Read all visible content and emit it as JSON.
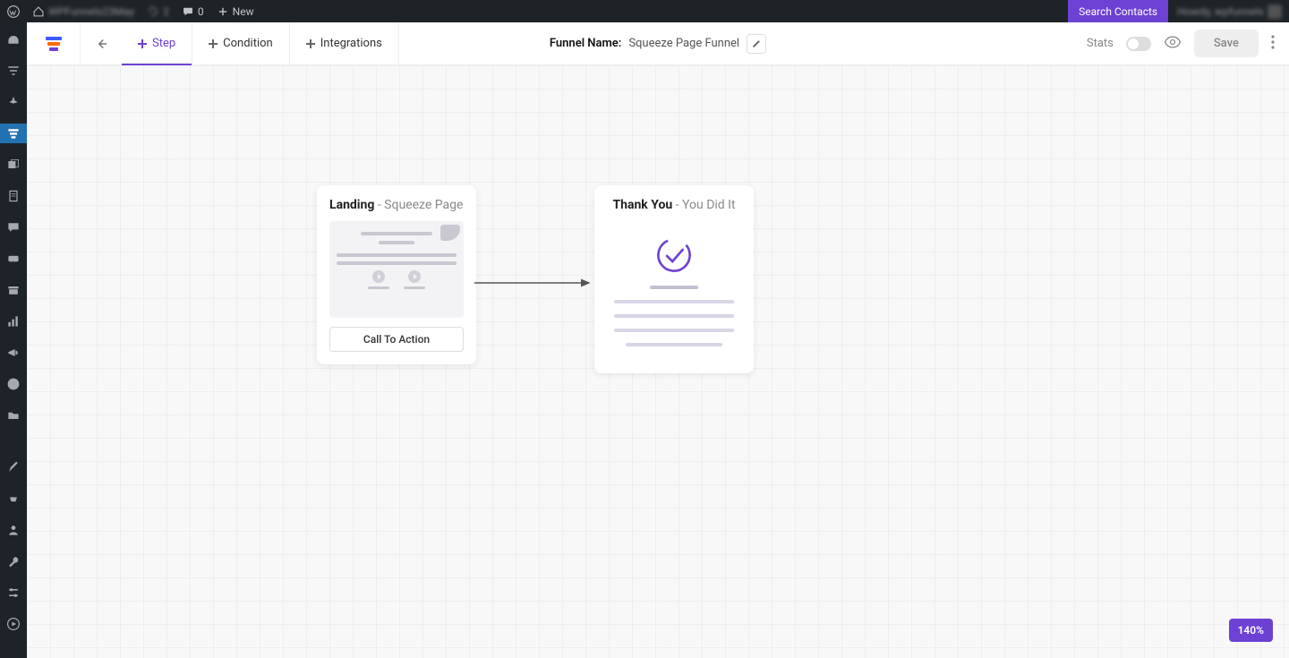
{
  "adminbar": {
    "site_name": "WPFunnels23May",
    "notif_count": "2",
    "comment_count": "0",
    "new_label": "New",
    "search_contacts": "Search Contacts",
    "howdy": "Howdy, wpfunnels"
  },
  "toolbar": {
    "tabs": {
      "step": "Step",
      "condition": "Condition",
      "integrations": "Integrations"
    },
    "funnel_label": "Funnel Name:",
    "funnel_value": "Squeeze Page Funnel",
    "stats": "Stats",
    "save": "Save"
  },
  "nodes": {
    "landing": {
      "title": "Landing",
      "subtitle": " - Squeeze Page",
      "cta": "Call To Action"
    },
    "thankyou": {
      "title": "Thank You",
      "subtitle": " - You Did It"
    }
  },
  "zoom": "140%"
}
